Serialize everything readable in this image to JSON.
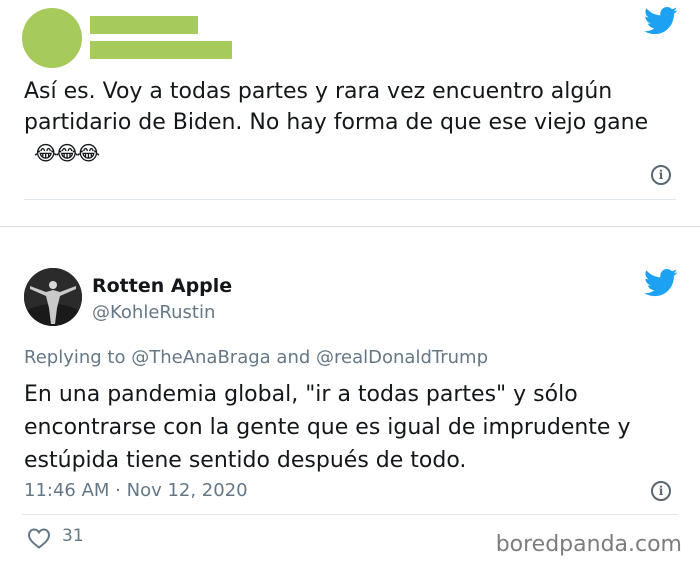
{
  "tweet1": {
    "text": "Así es. Voy a todas partes y rara vez encuentro algún partidario de Biden. No hay forma de que ese viejo gane",
    "emoji": "😂😂😂"
  },
  "tweet2": {
    "display_name": "Rotten Apple",
    "handle": "@KohleRustin",
    "replying_prefix": "Replying to",
    "reply_to_1": "@TheAnaBraga",
    "reply_and": "and",
    "reply_to_2": "@realDonaldTrump",
    "text": "En una pandemia global, \"ir a todas partes\" y sólo encontrarse con la gente que es igual de imprudente y estúpida tiene sentido después de todo.",
    "timestamp": "11:46 AM · Nov 12, 2020",
    "likes": "31"
  },
  "watermark": "boredpanda.com",
  "icons": {
    "brand": "twitter-bird-icon",
    "info": "info-icon",
    "like": "heart-icon"
  },
  "colors": {
    "twitter_blue": "#1da1f2",
    "redaction_green": "#a6cb5b",
    "secondary_text": "#657786"
  }
}
